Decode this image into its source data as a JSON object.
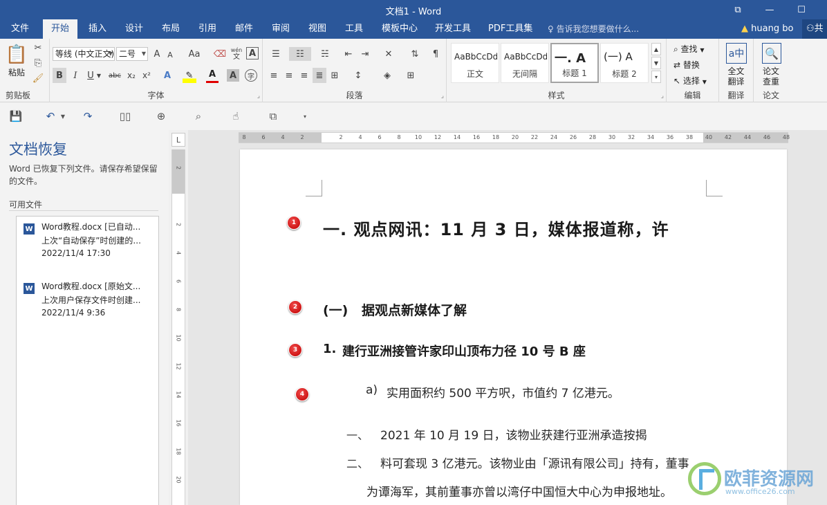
{
  "window": {
    "title": "文档1 - Word",
    "btn_restore": "⧉",
    "btn_minimize": "—",
    "btn_maximize": "☐"
  },
  "tabs": [
    "文件",
    "开始",
    "插入",
    "设计",
    "布局",
    "引用",
    "邮件",
    "审阅",
    "视图",
    "工具",
    "模板中心",
    "开发工具",
    "PDF工具集"
  ],
  "tell_me": "告诉我您想要做什么...",
  "user": "huang bo",
  "share": "共",
  "ribbon": {
    "clipboard": {
      "label": "剪贴板",
      "paste": "粘贴"
    },
    "font": {
      "label": "字体",
      "font_name": "等线 (中文正文)",
      "font_size": "二号",
      "wen": "wén",
      "wen_char": "文",
      "bold": "B",
      "italic": "I",
      "underline": "U",
      "strike": "abc",
      "sub": "x₂",
      "sup": "x²",
      "grow": "A",
      "shrink": "A",
      "case": "Aa",
      "text_effect": "A",
      "font_color": "A",
      "char_shade": "A",
      "enclose": "字"
    },
    "paragraph": {
      "label": "段落"
    },
    "styles": {
      "label": "样式",
      "items": [
        {
          "preview": "AaBbCcDd",
          "name": "正文"
        },
        {
          "preview": "AaBbCcDd",
          "name": "无间隔"
        },
        {
          "preview": "一.  A",
          "name": "标题 1"
        },
        {
          "preview": "(一)  A",
          "name": "标题 2"
        }
      ]
    },
    "editing": {
      "label": "编辑",
      "find": "查找",
      "replace": "替换",
      "select": "选择"
    },
    "translate": {
      "label": "翻译",
      "line1": "全文",
      "line2": "翻译"
    },
    "paper": {
      "label": "论文",
      "line1": "论文",
      "line2": "查重"
    }
  },
  "recovery": {
    "title": "文档恢复",
    "desc": "Word 已恢复下列文件。请保存希望保留的文件。",
    "available": "可用文件",
    "files": [
      {
        "name": "Word教程.docx  [已自动...",
        "desc": "上次“自动保存”时创建的...",
        "time": "2022/11/4 17:30"
      },
      {
        "name": "Word教程.docx  [原始文...",
        "desc": "上次用户保存文件时创建...",
        "time": "2022/11/4 9:36"
      }
    ]
  },
  "ruler": {
    "corner": "L",
    "h_ticks": [
      "8",
      "6",
      "4",
      "2",
      "",
      "2",
      "4",
      "6",
      "8",
      "10",
      "12",
      "14",
      "16",
      "18",
      "20",
      "22",
      "24",
      "26",
      "28",
      "30",
      "32",
      "34",
      "36",
      "38",
      "40",
      "42",
      "44",
      "46",
      "48"
    ],
    "v_ticks": [
      "2",
      "",
      "2",
      "4",
      "6",
      "8",
      "10",
      "12",
      "14",
      "16",
      "18",
      "20"
    ]
  },
  "document": {
    "markers": [
      "1",
      "2",
      "3",
      "4"
    ],
    "h1": "一.  观点网讯：11 月 3 日，媒体报道称，许",
    "h2_num": "(一)",
    "h2": "据观点新媒体了解",
    "h3_num": "1.",
    "h3": "建行亚洲接管许家印山顶布力径 10 号 B 座",
    "item_a_num": "a)",
    "item_a": "实用面积约 500 平方呎，市值约 7 亿港元。",
    "list1_num": "一、",
    "list1": "2021 年 10 月 19 日，该物业获建行亚洲承造按揭",
    "list2_num": "二、",
    "list2": "料可套现 3 亿港元。该物业由「源讯有限公司」持有，董事",
    "list2_cont": "为谭海军，其前董事亦曾以湾仔中国恒大中心为申报地址。"
  },
  "watermark": {
    "text": "欧菲资源网",
    "url": "www.office26.com"
  },
  "colors": {
    "accent": "#2b579a",
    "marker": "#c00000",
    "ribbon_bg": "#f3f3f3"
  }
}
